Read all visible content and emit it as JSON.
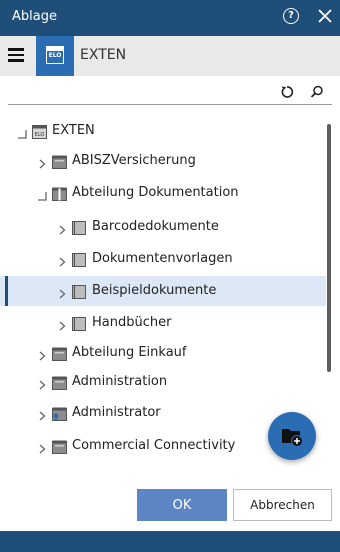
{
  "dialog": {
    "title": "Ablage"
  },
  "toolbar": {
    "breadcrumb": "EXTEN"
  },
  "tree": {
    "items": [
      {
        "label": "EXTEN",
        "icon": "archive-root-icon",
        "expander": "expanded"
      },
      {
        "label": "ABISZVersicherung",
        "icon": "cabinet-icon",
        "expander": "collapsed"
      },
      {
        "label": "Abteilung Dokumentation",
        "icon": "cabinet-open-icon",
        "expander": "expanded"
      },
      {
        "label": "Barcodedokumente",
        "icon": "folder-icon",
        "expander": "collapsed"
      },
      {
        "label": "Dokumentenvorlagen",
        "icon": "folder-icon",
        "expander": "collapsed"
      },
      {
        "label": "Beispieldokumente",
        "icon": "folder-icon",
        "expander": "collapsed",
        "selected": true
      },
      {
        "label": "Handbücher",
        "icon": "folder-icon",
        "expander": "collapsed"
      },
      {
        "label": "Abteilung Einkauf",
        "icon": "cabinet-icon",
        "expander": "collapsed"
      },
      {
        "label": "Administration",
        "icon": "cabinet-icon",
        "expander": "collapsed"
      },
      {
        "label": "Administrator",
        "icon": "user-cabinet-icon",
        "expander": "collapsed"
      },
      {
        "label": "Commercial Connectivity",
        "icon": "cabinet-icon",
        "expander": "collapsed"
      }
    ]
  },
  "buttons": {
    "ok": "OK",
    "cancel": "Abbrechen"
  },
  "colors": {
    "header": "#1f4e79",
    "accent": "#2b6db3",
    "selection": "#dce8f5",
    "ok_button": "#5b86c3"
  }
}
